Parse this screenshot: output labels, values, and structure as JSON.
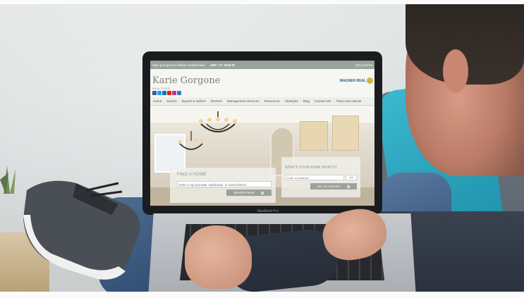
{
  "website": {
    "topbar": {
      "message": "Sign up to get new listings emailed daily!",
      "join": "JOIN",
      "or": "OR",
      "signin": "SIGN IN",
      "phone": "(941) 313-54"
    },
    "header": {
      "title": "Karie Gorgone",
      "subtitle": "REALTOR®",
      "logo_text": "WAGNER REAL"
    },
    "nav": [
      "Home",
      "Search",
      "Buyers & Sellers",
      "Renters",
      "Management Services",
      "Resources",
      "Lifestyles",
      "Blog",
      "Contact Me",
      "*New Area eBook"
    ],
    "find_home": {
      "title": "FIND A HOME",
      "placeholder": "Enter a city and state, subdivision, or school district",
      "button": "SEARCH NOW"
    },
    "home_worth": {
      "title": "WHAT'S YOUR HOME WORTH?",
      "placeholder": "Enter an Address",
      "unit": "Unit",
      "button": "GET MY REPORT"
    }
  },
  "laptop": {
    "brand": "MacBook Pro"
  },
  "colors": {
    "site_accent": "#9aa39a",
    "pillow": "#2aa6bf",
    "logo_blue": "#2f5f8f",
    "logo_gold": "#d4b43c"
  }
}
